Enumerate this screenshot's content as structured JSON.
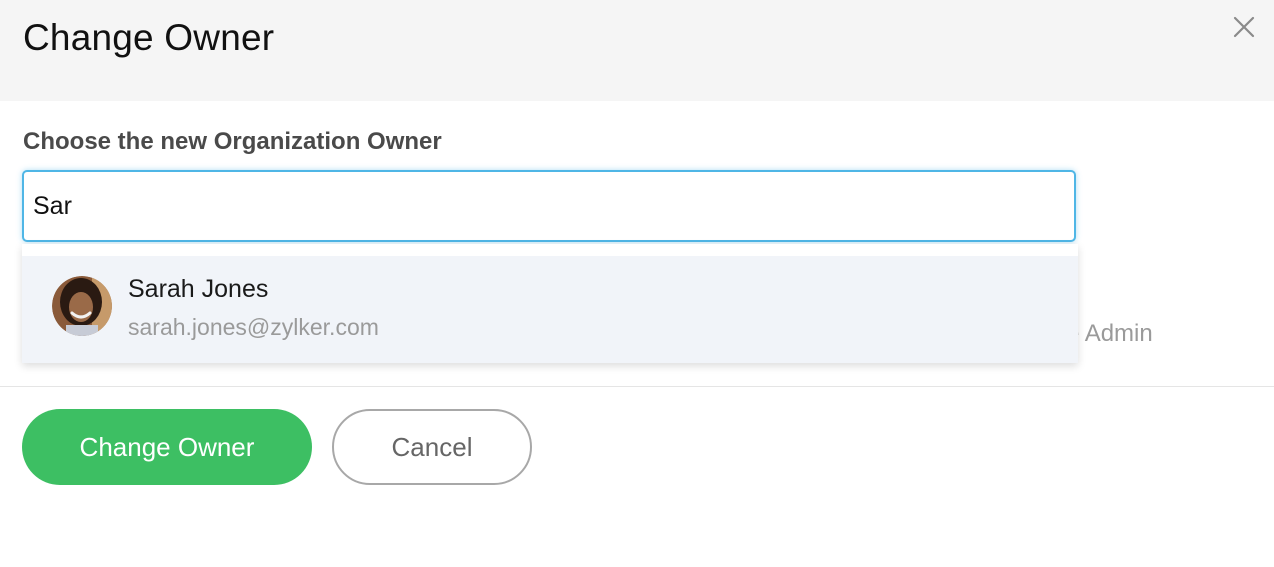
{
  "dialog": {
    "title": "Change Owner",
    "close_icon": "close-icon"
  },
  "form": {
    "label": "Choose the new Organization Owner",
    "search_value": "Sar",
    "background_partial_text": "e Admin"
  },
  "suggestions": [
    {
      "name": "Sarah Jones",
      "email": "sarah.jones@zylker.com",
      "avatar_icon": "user-avatar"
    }
  ],
  "actions": {
    "primary_label": "Change Owner",
    "secondary_label": "Cancel"
  },
  "colors": {
    "accent_green": "#3dbf63",
    "focus_blue": "#4fb6e6",
    "header_bg": "#f5f5f5",
    "option_bg": "#f1f4f9"
  }
}
